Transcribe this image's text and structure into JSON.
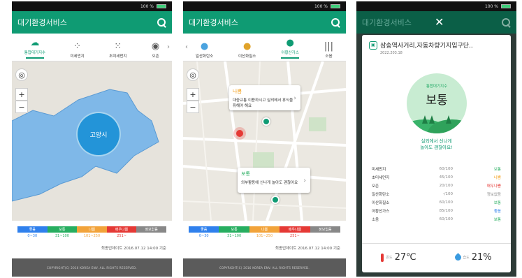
{
  "status": {
    "battery": "100 %"
  },
  "app": {
    "title": "대기환경서비스"
  },
  "screen1": {
    "tabs": [
      {
        "label": "통합대기지수",
        "icon": "cloud-icon"
      },
      {
        "label": "미세먼지",
        "icon": "dust-icon"
      },
      {
        "label": "초미세먼지",
        "icon": "fine-dust-icon"
      },
      {
        "label": "오존",
        "icon": "ozone-icon"
      }
    ],
    "region_label": "고양시"
  },
  "screen2": {
    "tabs": [
      {
        "label": "일산화탄소",
        "icon": "drop-icon"
      },
      {
        "label": "이산화질소",
        "icon": "drop-icon"
      },
      {
        "label": "아황산가스",
        "icon": "drop-icon"
      },
      {
        "label": "소음",
        "icon": "sound-icon"
      }
    ],
    "popups": [
      {
        "title": "나쁨",
        "title_color": "#f39c12",
        "text": "대중교통 이용하시고 실외에서 휴식을 취해야 해요"
      },
      {
        "title": "보통",
        "title_color": "#27ae60",
        "text": "외부활동에 신나게 놀아도 괜찮아요"
      }
    ]
  },
  "legend": {
    "levels": [
      {
        "label": "좋음",
        "color": "#2f80ed",
        "range": "0~30",
        "range_color": "#2f80ed"
      },
      {
        "label": "보통",
        "color": "#27ae60",
        "range": "31~100",
        "range_color": "#27ae60"
      },
      {
        "label": "나쁨",
        "color": "#f2a33a",
        "range": "101~250",
        "range_color": "#f2a33a"
      },
      {
        "label": "매우나쁨",
        "color": "#e53935",
        "range": "251~",
        "range_color": "#e53935"
      },
      {
        "label": "정보없음",
        "color": "#888888",
        "range": "",
        "range_color": "#888888"
      }
    ],
    "updated": "최종업데이트 2016.07.12 14:00 기준"
  },
  "footer": "COPYRIGHT(C) 2016 KOREA ENV. ALL RIGHTS RESERVED.",
  "screen3": {
    "station": "삼송역사거리,자동차량기지입구단..",
    "date": "2022.203.18",
    "index_label": "통합대기지수",
    "index_value": "보통",
    "message_line1": "실외에서 신나게",
    "message_line2": "놀아도 괜찮아요!",
    "rows": [
      {
        "name": "미세먼지",
        "value": "60/100",
        "grade": "보통",
        "grade_color": "#27ae60"
      },
      {
        "name": "초미세먼지",
        "value": "45/100",
        "grade": "나쁨",
        "grade_color": "#f39c12"
      },
      {
        "name": "오존",
        "value": "20/100",
        "grade": "매우나쁨",
        "grade_color": "#e53935"
      },
      {
        "name": "일산화탄소",
        "value": "-/100",
        "grade": "정보없음",
        "grade_color": "#888888"
      },
      {
        "name": "이산화질소",
        "value": "60/100",
        "grade": "보통",
        "grade_color": "#27ae60"
      },
      {
        "name": "아황산가스",
        "value": "85/100",
        "grade": "좋음",
        "grade_color": "#2f80ed"
      },
      {
        "name": "소음",
        "value": "60/100",
        "grade": "보통",
        "grade_color": "#27ae60"
      }
    ],
    "temp_label": "온도",
    "temp_value": "27℃",
    "humidity_label": "습도",
    "humidity_value": "21%"
  }
}
